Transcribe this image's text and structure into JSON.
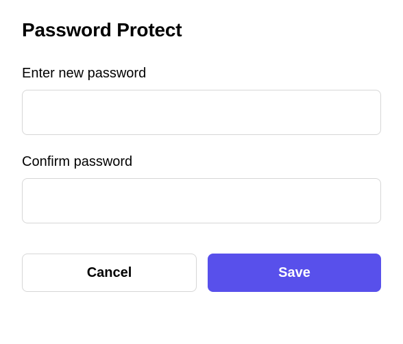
{
  "title": "Password Protect",
  "fields": {
    "new_password": {
      "label": "Enter new password",
      "value": ""
    },
    "confirm_password": {
      "label": "Confirm password",
      "value": ""
    }
  },
  "buttons": {
    "cancel": "Cancel",
    "save": "Save"
  }
}
